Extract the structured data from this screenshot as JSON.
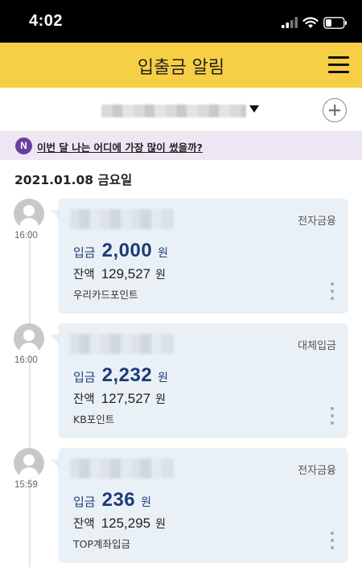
{
  "status_bar": {
    "time": "4:02"
  },
  "header": {
    "title": "입출금 알림",
    "menu_icon": "hamburger-menu-icon"
  },
  "account": {
    "add_icon": "plus-circle-icon"
  },
  "notice": {
    "badge": "N",
    "text": "이번 달 나는 어디에 가장 많이 썼을까?"
  },
  "date_heading": "2021.01.08 금요일",
  "entries": [
    {
      "time": "16:00",
      "category": "전자금융",
      "deposit_label": "입금",
      "deposit_amount": "2,000",
      "deposit_unit": "원",
      "balance_label": "잔액",
      "balance_amount": "129,527",
      "balance_unit": "원",
      "memo": "우리카드포인트"
    },
    {
      "time": "16:00",
      "category": "대체입금",
      "deposit_label": "입금",
      "deposit_amount": "2,232",
      "deposit_unit": "원",
      "balance_label": "잔액",
      "balance_amount": "127,527",
      "balance_unit": "원",
      "memo": "KB포인트"
    },
    {
      "time": "15:59",
      "category": "전자금융",
      "deposit_label": "입금",
      "deposit_amount": "236",
      "deposit_unit": "원",
      "balance_label": "잔액",
      "balance_amount": "125,295",
      "balance_unit": "원",
      "memo": "TOP계좌입금"
    }
  ],
  "colors": {
    "header_bg": "#f7cf45",
    "card_bg": "#eaf1f6",
    "deposit_text": "#1d3b78",
    "notice_bg": "#ece7f3",
    "badge_bg": "#6a3fa0"
  }
}
